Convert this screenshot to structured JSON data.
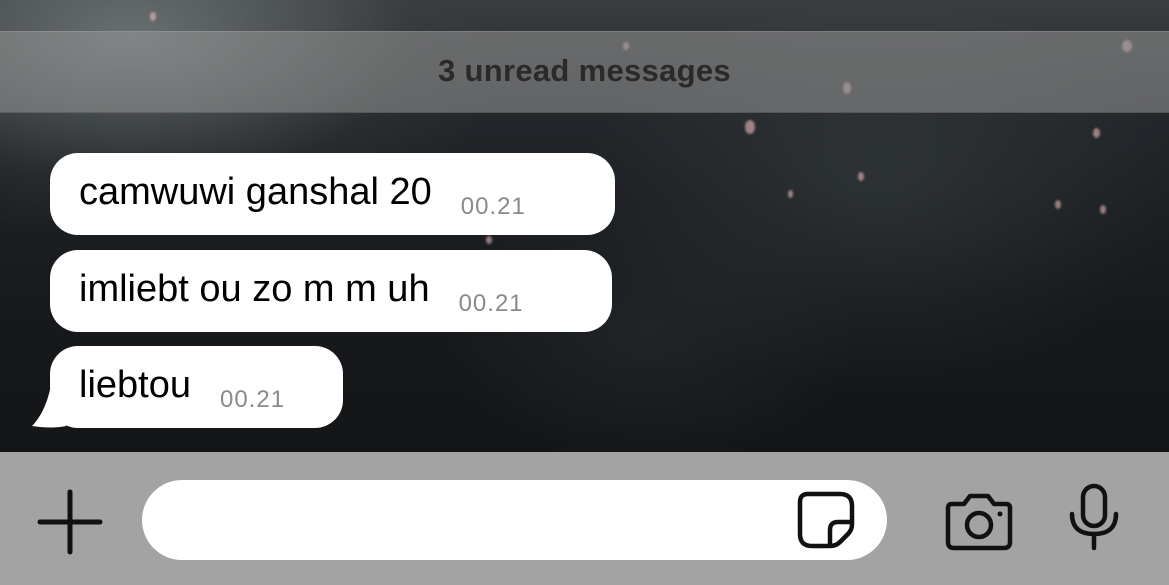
{
  "unread_banner": {
    "text": "3 unread messages"
  },
  "messages": [
    {
      "text": "camwuwi ganshal 20",
      "time": "00.21"
    },
    {
      "text": "imliebt ou zo m m uh",
      "time": "00.21"
    },
    {
      "text": "liebtou",
      "time": "00.21"
    }
  ],
  "composer": {
    "placeholder": "",
    "value": "",
    "icons": {
      "add": "plus-icon",
      "sticker": "sticker-icon",
      "camera": "camera-icon",
      "microphone": "microphone-icon"
    }
  },
  "colors": {
    "bubble": "#ffffff",
    "input_bar": "#a3a3a3",
    "unread_bar": "#8c8c8c",
    "timestamp": "#8a8a8a"
  }
}
